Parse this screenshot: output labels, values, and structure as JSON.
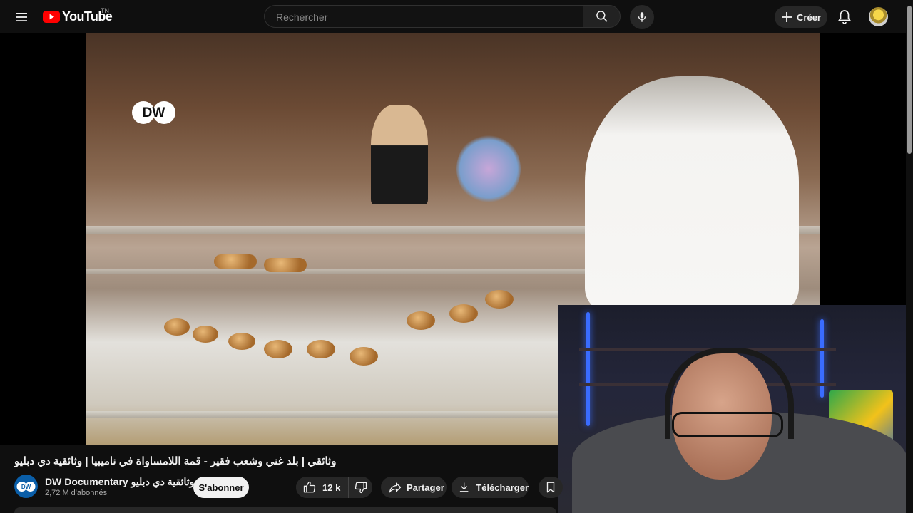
{
  "header": {
    "logo_text": "YouTube",
    "country_code": "TN",
    "search_placeholder": "Rechercher",
    "create_label": "Créer"
  },
  "video_overlay": {
    "watermark": "DW"
  },
  "video": {
    "title": "وثائقي | بلد غني وشعب فقير - قمة اللامساواة في ناميبيا | وثائقية دي دبليو",
    "channel_name": "DW Documentary وثائقية دي دبليو",
    "subscribers": "2,72 M d'abonnés",
    "subscribe_label": "S'abonner",
    "like_count": "12 k",
    "share_label": "Partager",
    "download_label": "Télécharger"
  },
  "icons": {
    "menu": "hamburger-menu-icon",
    "search": "search-icon",
    "mic": "microphone-icon",
    "create": "plus-icon",
    "notifications": "bell-icon",
    "like": "thumbs-up-icon",
    "dislike": "thumbs-down-icon",
    "share": "share-arrow-icon",
    "download": "download-icon",
    "save": "bookmark-icon",
    "verified": "verified-check-icon"
  },
  "colors": {
    "background": "#0f0f0f",
    "youtube_red": "#ff0000",
    "pill_bg": "#272727",
    "subscribe_bg": "#f1f1f1",
    "dw_blue": "#0a5ea8"
  }
}
